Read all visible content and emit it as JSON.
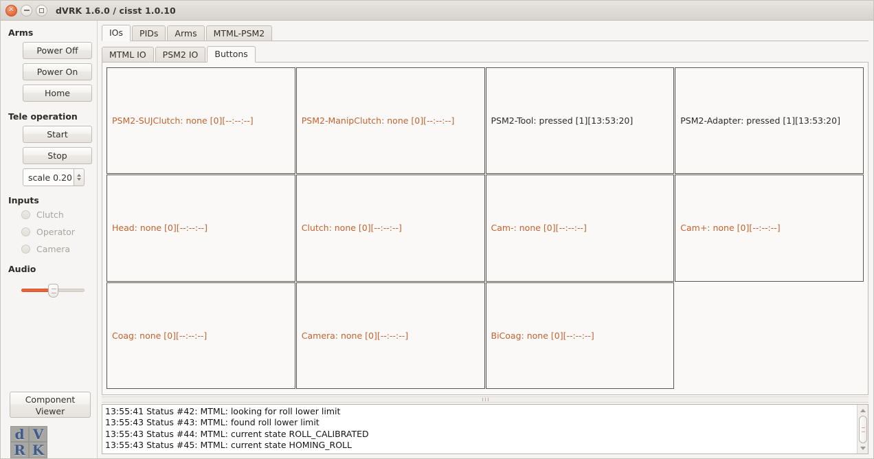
{
  "window": {
    "title": "dVRK 1.6.0 / cisst 1.0.10",
    "close_glyph": "×",
    "close_icon_name": "close-icon",
    "minimize_icon_name": "minimize-icon",
    "maximize_icon_name": "maximize-icon"
  },
  "sidebar": {
    "arms": {
      "title": "Arms",
      "buttons": [
        {
          "label": "Power Off"
        },
        {
          "label": "Power On"
        },
        {
          "label": "Home"
        }
      ]
    },
    "teleop": {
      "title": "Tele operation",
      "buttons": [
        {
          "label": "Start"
        },
        {
          "label": "Stop"
        }
      ],
      "scale_value": "scale 0.20"
    },
    "inputs": {
      "title": "Inputs",
      "radios": [
        {
          "label": "Clutch",
          "checked": false,
          "enabled": false
        },
        {
          "label": "Operator",
          "checked": false,
          "enabled": false
        },
        {
          "label": "Camera",
          "checked": false,
          "enabled": false
        }
      ]
    },
    "audio": {
      "title": "Audio",
      "volume_percent": 48
    },
    "component_viewer_label": "Component\nViewer",
    "component_viewer_line1": "Component",
    "component_viewer_line2": "Viewer",
    "logo": {
      "tiles": [
        "d",
        "V",
        "R",
        "K"
      ]
    }
  },
  "content": {
    "primary_tabs": [
      {
        "label": "IOs",
        "active": true
      },
      {
        "label": "PIDs",
        "active": false
      },
      {
        "label": "Arms",
        "active": false
      },
      {
        "label": "MTML-PSM2",
        "active": false
      }
    ],
    "secondary_tabs": [
      {
        "label": "MTML IO",
        "active": false
      },
      {
        "label": "PSM2 IO",
        "active": false
      },
      {
        "label": "Buttons",
        "active": true
      }
    ],
    "button_cells": [
      {
        "text": "PSM2-SUJClutch: none [0][--:--:--]",
        "state": "none"
      },
      {
        "text": "PSM2-ManipClutch: none [0][--:--:--]",
        "state": "none"
      },
      {
        "text": "PSM2-Tool: pressed [1][13:53:20]",
        "state": "pressed"
      },
      {
        "text": "PSM2-Adapter: pressed [1][13:53:20]",
        "state": "pressed"
      },
      {
        "text": "Head: none [0][--:--:--]",
        "state": "none"
      },
      {
        "text": "Clutch: none [0][--:--:--]",
        "state": "none"
      },
      {
        "text": "Cam-: none [0][--:--:--]",
        "state": "none"
      },
      {
        "text": "Cam+: none [0][--:--:--]",
        "state": "none"
      },
      {
        "text": "Coag: none [0][--:--:--]",
        "state": "none"
      },
      {
        "text": "Camera: none [0][--:--:--]",
        "state": "none"
      },
      {
        "text": "BiCoag: none [0][--:--:--]",
        "state": "none"
      },
      {
        "text": "",
        "state": "empty"
      }
    ]
  },
  "log": {
    "lines": [
      "13:55:41 Status #42: MTML: looking for roll lower limit",
      "13:55:43 Status #43: MTML: found roll lower limit",
      "13:55:43 Status #44: MTML: current state ROLL_CALIBRATED",
      "13:55:43 Status #45: MTML: current state HOMING_ROLL"
    ]
  },
  "colors": {
    "accent_orange": "#e8633a",
    "state_none_text": "#c4622f",
    "state_pressed_text": "#2d2a26",
    "window_bg": "#f6f5f3",
    "logo_blue": "#3f5b8c"
  }
}
